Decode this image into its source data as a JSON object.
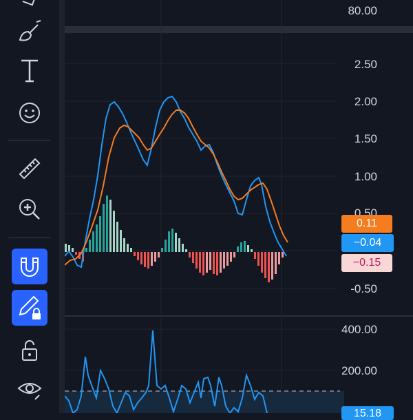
{
  "toolbar": {
    "tools": [
      {
        "name": "brush-icon",
        "active": false
      },
      {
        "name": "text-icon",
        "active": false
      },
      {
        "name": "emoji-icon",
        "active": false
      },
      {
        "name": "ruler-icon",
        "active": false
      },
      {
        "name": "zoom-in-icon",
        "active": false
      },
      {
        "name": "magnet-icon",
        "active": true
      },
      {
        "name": "pencil-lock-icon",
        "active": true
      },
      {
        "name": "unlock-icon",
        "active": false
      },
      {
        "name": "eye-icon",
        "active": false
      }
    ]
  },
  "top_pane": {
    "axis_labels": [
      "80.00"
    ]
  },
  "macd_pane": {
    "axis_labels": [
      "2.50",
      "2.00",
      "1.50",
      "1.00",
      "0.50",
      "-0.50"
    ],
    "badges": [
      {
        "text": "0.11",
        "bg": "#f57c1f",
        "fg": "#ffffff"
      },
      {
        "text": "−0.04",
        "bg": "#2196f3",
        "fg": "#ffffff"
      },
      {
        "text": "−0.15",
        "bg": "#f8d7d7",
        "fg": "#c2185b"
      }
    ],
    "colors": {
      "macd_line": "#2196f3",
      "signal_line": "#f57c1f",
      "hist_up": "#a5d6c7",
      "hist_up_strong": "#26a69a",
      "hist_down": "#ef9a9a",
      "hist_down_strong": "#ef5350"
    }
  },
  "volume_pane": {
    "axis_labels": [
      "400.00",
      "200.00"
    ],
    "badge_partial": "15.18",
    "line_color": "#2196f3"
  },
  "colors": {
    "background": "#131722",
    "accent": "#2962ff",
    "text": "#d1d4dc",
    "grid": "#232632"
  }
}
